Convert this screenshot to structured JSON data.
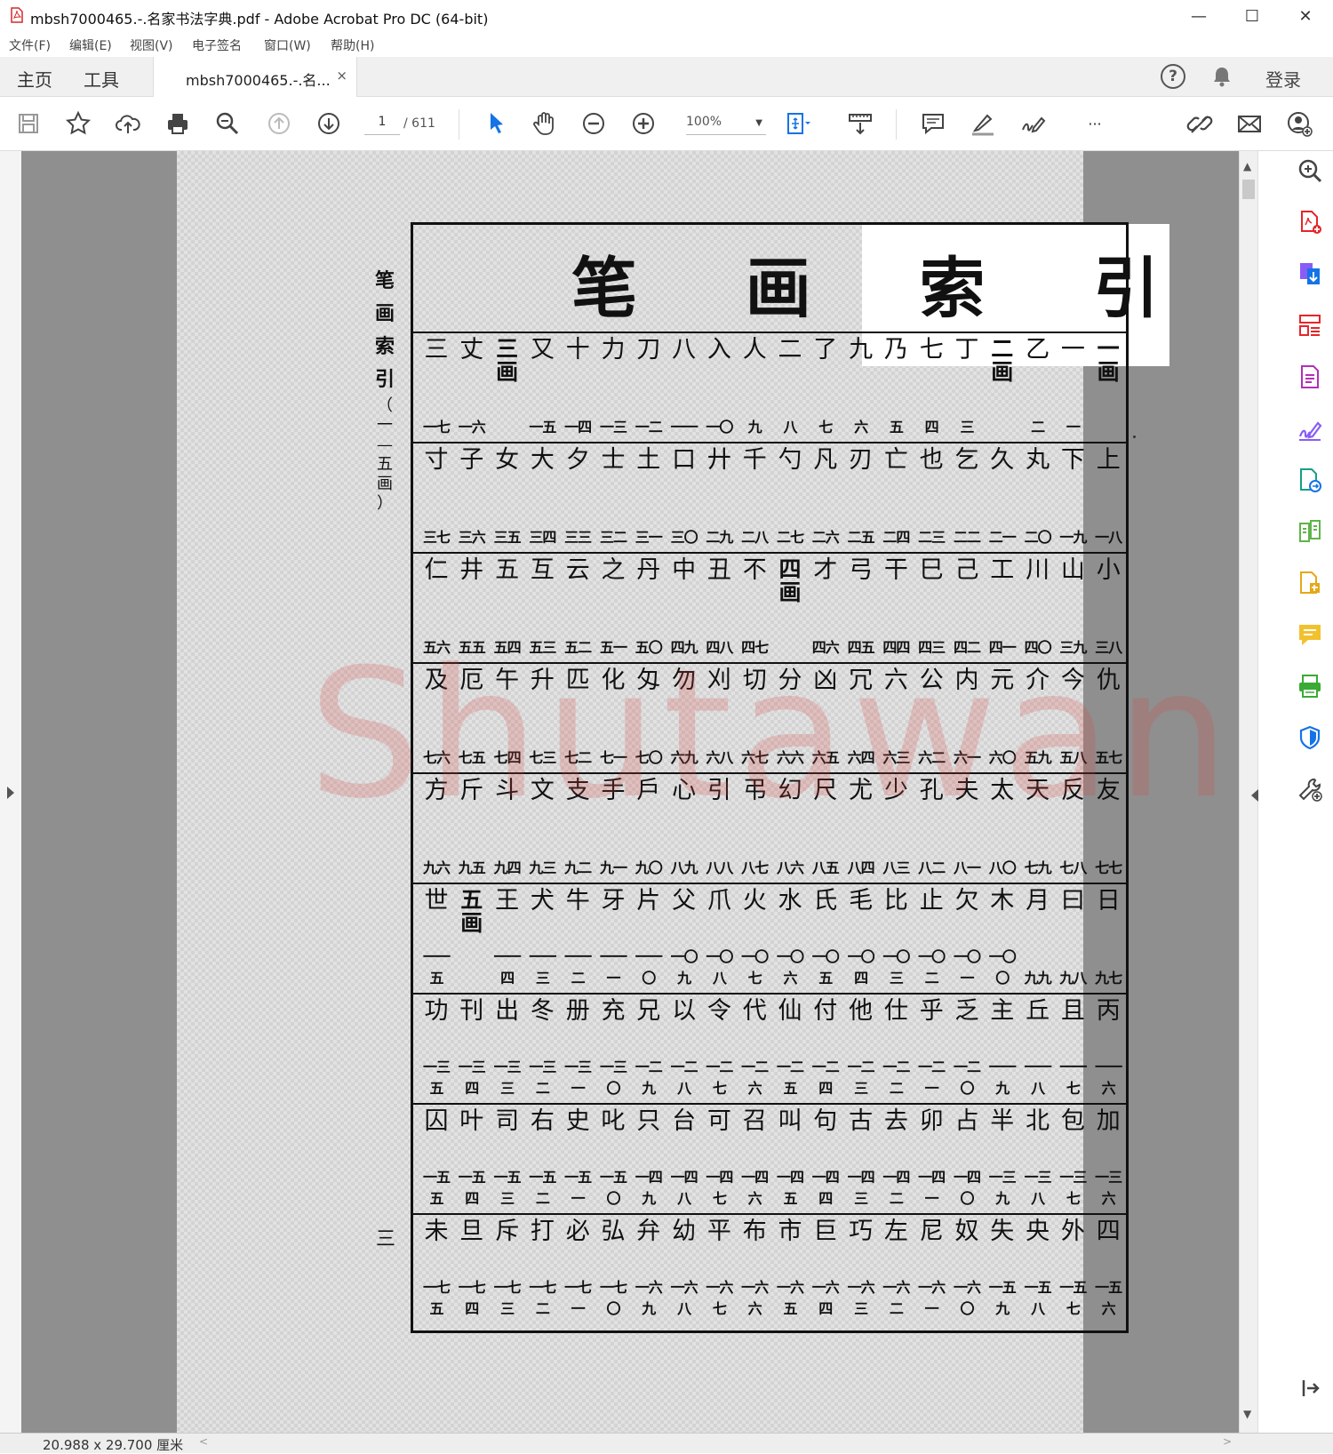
{
  "window": {
    "title": "mbsh7000465.-.名家书法字典.pdf - Adobe Acrobat Pro DC (64-bit)",
    "minimize": "—",
    "maximize": "☐",
    "close": "✕"
  },
  "menu": [
    "文件(F)",
    "编辑(E)",
    "视图(V)",
    "电子签名",
    "窗口(W)",
    "帮助(H)"
  ],
  "tabs": {
    "home": "主页",
    "tools": "工具",
    "document": "mbsh7000465.-.名...",
    "document_close": "×",
    "help": "?",
    "login": "登录"
  },
  "toolbar": {
    "page_current": "1",
    "page_total": "/ 611",
    "zoom": "100%",
    "more": "···"
  },
  "page": {
    "title": "笔 画 索 引",
    "side_label": [
      "笔",
      "画",
      "索",
      "引"
    ],
    "side_range": [
      "（",
      "一",
      "—",
      "五",
      "画",
      "）"
    ],
    "page_number": "三",
    "watermark": "Shutawang.CN",
    "rows": [
      {
        "cells": [
          {
            "ch": "一",
            "big": true,
            "sub": "画",
            "pg": ""
          },
          {
            "ch": "一",
            "pg": "一"
          },
          {
            "ch": "乙",
            "pg": "二"
          },
          {
            "ch": "二",
            "big": true,
            "sub": "画",
            "pg": ""
          },
          {
            "ch": "丁",
            "pg": "三"
          },
          {
            "ch": "七",
            "pg": "四"
          },
          {
            "ch": "乃",
            "pg": "五"
          },
          {
            "ch": "九",
            "pg": "六"
          },
          {
            "ch": "了",
            "pg": "七"
          },
          {
            "ch": "二",
            "pg": "八"
          },
          {
            "ch": "人",
            "pg": "九"
          },
          {
            "ch": "入",
            "pg": "一〇"
          },
          {
            "ch": "八",
            "pg": "一一"
          },
          {
            "ch": "刀",
            "pg": "一二"
          },
          {
            "ch": "力",
            "pg": "一三"
          },
          {
            "ch": "十",
            "pg": "一四"
          },
          {
            "ch": "又",
            "pg": "一五"
          },
          {
            "ch": "三",
            "big": true,
            "sub": "画",
            "pg": ""
          },
          {
            "ch": "丈",
            "pg": "一六"
          },
          {
            "ch": "三",
            "pg": "一七"
          }
        ]
      },
      {
        "cells": [
          {
            "ch": "上",
            "pg": "一八"
          },
          {
            "ch": "下",
            "pg": "一九"
          },
          {
            "ch": "丸",
            "pg": "二〇"
          },
          {
            "ch": "久",
            "pg": "二一"
          },
          {
            "ch": "乞",
            "pg": "二二"
          },
          {
            "ch": "也",
            "pg": "二三"
          },
          {
            "ch": "亡",
            "pg": "二四"
          },
          {
            "ch": "刃",
            "pg": "二五"
          },
          {
            "ch": "凡",
            "pg": "二六"
          },
          {
            "ch": "勺",
            "pg": "二七"
          },
          {
            "ch": "千",
            "pg": "二八"
          },
          {
            "ch": "廾",
            "pg": "二九"
          },
          {
            "ch": "口",
            "pg": "三〇"
          },
          {
            "ch": "土",
            "pg": "三一"
          },
          {
            "ch": "士",
            "pg": "三二"
          },
          {
            "ch": "夕",
            "pg": "三三"
          },
          {
            "ch": "大",
            "pg": "三四"
          },
          {
            "ch": "女",
            "pg": "三五"
          },
          {
            "ch": "子",
            "pg": "三六"
          },
          {
            "ch": "寸",
            "pg": "三七"
          }
        ]
      },
      {
        "cells": [
          {
            "ch": "小",
            "pg": "三八"
          },
          {
            "ch": "山",
            "pg": "三九"
          },
          {
            "ch": "川",
            "pg": "四〇"
          },
          {
            "ch": "工",
            "pg": "四一"
          },
          {
            "ch": "己",
            "pg": "四二"
          },
          {
            "ch": "巳",
            "pg": "四三"
          },
          {
            "ch": "干",
            "pg": "四四"
          },
          {
            "ch": "弓",
            "pg": "四五"
          },
          {
            "ch": "才",
            "pg": "四六"
          },
          {
            "ch": "四",
            "big": true,
            "sub": "画",
            "pg": ""
          },
          {
            "ch": "不",
            "pg": "四七"
          },
          {
            "ch": "丑",
            "pg": "四八"
          },
          {
            "ch": "中",
            "pg": "四九"
          },
          {
            "ch": "丹",
            "pg": "五〇"
          },
          {
            "ch": "之",
            "pg": "五一"
          },
          {
            "ch": "云",
            "pg": "五二"
          },
          {
            "ch": "互",
            "pg": "五三"
          },
          {
            "ch": "五",
            "pg": "五四"
          },
          {
            "ch": "井",
            "pg": "五五"
          },
          {
            "ch": "仁",
            "pg": "五六"
          }
        ]
      },
      {
        "cells": [
          {
            "ch": "仇",
            "pg": "五七"
          },
          {
            "ch": "今",
            "pg": "五八"
          },
          {
            "ch": "介",
            "pg": "五九"
          },
          {
            "ch": "元",
            "pg": "六〇"
          },
          {
            "ch": "内",
            "pg": "六一"
          },
          {
            "ch": "公",
            "pg": "六二"
          },
          {
            "ch": "六",
            "pg": "六三"
          },
          {
            "ch": "冗",
            "pg": "六四"
          },
          {
            "ch": "凶",
            "pg": "六五"
          },
          {
            "ch": "分",
            "pg": "六六"
          },
          {
            "ch": "切",
            "pg": "六七"
          },
          {
            "ch": "刈",
            "pg": "六八"
          },
          {
            "ch": "勿",
            "pg": "六九"
          },
          {
            "ch": "匁",
            "pg": "七〇"
          },
          {
            "ch": "化",
            "pg": "七一"
          },
          {
            "ch": "匹",
            "pg": "七二"
          },
          {
            "ch": "升",
            "pg": "七三"
          },
          {
            "ch": "午",
            "pg": "七四"
          },
          {
            "ch": "厄",
            "pg": "七五"
          },
          {
            "ch": "及",
            "pg": "七六"
          }
        ]
      },
      {
        "cells": [
          {
            "ch": "友",
            "pg": "七七"
          },
          {
            "ch": "反",
            "pg": "七八"
          },
          {
            "ch": "天",
            "pg": "七九"
          },
          {
            "ch": "太",
            "pg": "八〇"
          },
          {
            "ch": "夫",
            "pg": "八一"
          },
          {
            "ch": "孔",
            "pg": "八二"
          },
          {
            "ch": "少",
            "pg": "八三"
          },
          {
            "ch": "尤",
            "pg": "八四"
          },
          {
            "ch": "尺",
            "pg": "八五"
          },
          {
            "ch": "幻",
            "pg": "八六"
          },
          {
            "ch": "弔",
            "pg": "八七"
          },
          {
            "ch": "引",
            "pg": "八八"
          },
          {
            "ch": "心",
            "pg": "八九"
          },
          {
            "ch": "戶",
            "pg": "九〇"
          },
          {
            "ch": "手",
            "pg": "九一"
          },
          {
            "ch": "支",
            "pg": "九二"
          },
          {
            "ch": "文",
            "pg": "九三"
          },
          {
            "ch": "斗",
            "pg": "九四"
          },
          {
            "ch": "斤",
            "pg": "九五"
          },
          {
            "ch": "方",
            "pg": "九六"
          }
        ]
      },
      {
        "cells": [
          {
            "ch": "日",
            "pg": "九七"
          },
          {
            "ch": "曰",
            "pg": "九八"
          },
          {
            "ch": "月",
            "pg": "九九"
          },
          {
            "ch": "木",
            "pg": "一〇〇"
          },
          {
            "ch": "欠",
            "pg": "一〇一"
          },
          {
            "ch": "止",
            "pg": "一〇二"
          },
          {
            "ch": "比",
            "pg": "一〇三"
          },
          {
            "ch": "毛",
            "pg": "一〇四"
          },
          {
            "ch": "氏",
            "pg": "一〇五"
          },
          {
            "ch": "水",
            "pg": "一〇六"
          },
          {
            "ch": "火",
            "pg": "一〇七"
          },
          {
            "ch": "爪",
            "pg": "一〇八"
          },
          {
            "ch": "父",
            "pg": "一〇九"
          },
          {
            "ch": "片",
            "pg": "一一〇"
          },
          {
            "ch": "牙",
            "pg": "一一一"
          },
          {
            "ch": "牛",
            "pg": "一一二"
          },
          {
            "ch": "犬",
            "pg": "一一三"
          },
          {
            "ch": "王",
            "pg": "一一四"
          },
          {
            "ch": "五",
            "big": true,
            "sub": "画",
            "pg": ""
          },
          {
            "ch": "世",
            "pg": "一一五"
          }
        ]
      },
      {
        "cells": [
          {
            "ch": "丙",
            "pg": "一一六"
          },
          {
            "ch": "且",
            "pg": "一一七"
          },
          {
            "ch": "丘",
            "pg": "一一八"
          },
          {
            "ch": "主",
            "pg": "一一九"
          },
          {
            "ch": "乏",
            "pg": "一二〇"
          },
          {
            "ch": "乎",
            "pg": "一二一"
          },
          {
            "ch": "仕",
            "pg": "一二二"
          },
          {
            "ch": "他",
            "pg": "一二三"
          },
          {
            "ch": "付",
            "pg": "一二四"
          },
          {
            "ch": "仙",
            "pg": "一二五"
          },
          {
            "ch": "代",
            "pg": "一二六"
          },
          {
            "ch": "令",
            "pg": "一二七"
          },
          {
            "ch": "以",
            "pg": "一二八"
          },
          {
            "ch": "兄",
            "pg": "一二九"
          },
          {
            "ch": "充",
            "pg": "一三〇"
          },
          {
            "ch": "册",
            "pg": "一三一"
          },
          {
            "ch": "冬",
            "pg": "一三二"
          },
          {
            "ch": "出",
            "pg": "一三三"
          },
          {
            "ch": "刊",
            "pg": "一三四"
          },
          {
            "ch": "功",
            "pg": "一三五"
          }
        ]
      },
      {
        "cells": [
          {
            "ch": "加",
            "pg": "一三六"
          },
          {
            "ch": "包",
            "pg": "一三七"
          },
          {
            "ch": "北",
            "pg": "一三八"
          },
          {
            "ch": "半",
            "pg": "一三九"
          },
          {
            "ch": "占",
            "pg": "一四〇"
          },
          {
            "ch": "卯",
            "pg": "一四一"
          },
          {
            "ch": "去",
            "pg": "一四二"
          },
          {
            "ch": "古",
            "pg": "一四三"
          },
          {
            "ch": "句",
            "pg": "一四四"
          },
          {
            "ch": "叫",
            "pg": "一四五"
          },
          {
            "ch": "召",
            "pg": "一四六"
          },
          {
            "ch": "可",
            "pg": "一四七"
          },
          {
            "ch": "台",
            "pg": "一四八"
          },
          {
            "ch": "只",
            "pg": "一四九"
          },
          {
            "ch": "叱",
            "pg": "一五〇"
          },
          {
            "ch": "史",
            "pg": "一五一"
          },
          {
            "ch": "右",
            "pg": "一五二"
          },
          {
            "ch": "司",
            "pg": "一五三"
          },
          {
            "ch": "叶",
            "pg": "一五四"
          },
          {
            "ch": "囚",
            "pg": "一五五"
          }
        ]
      },
      {
        "cells": [
          {
            "ch": "四",
            "pg": "一五六"
          },
          {
            "ch": "外",
            "pg": "一五七"
          },
          {
            "ch": "央",
            "pg": "一五八"
          },
          {
            "ch": "失",
            "pg": "一五九"
          },
          {
            "ch": "奴",
            "pg": "一六〇"
          },
          {
            "ch": "尼",
            "pg": "一六一"
          },
          {
            "ch": "左",
            "pg": "一六二"
          },
          {
            "ch": "巧",
            "pg": "一六三"
          },
          {
            "ch": "巨",
            "pg": "一六四"
          },
          {
            "ch": "市",
            "pg": "一六五"
          },
          {
            "ch": "布",
            "pg": "一六六"
          },
          {
            "ch": "平",
            "pg": "一六七"
          },
          {
            "ch": "幼",
            "pg": "一六八"
          },
          {
            "ch": "弁",
            "pg": "一六九"
          },
          {
            "ch": "弘",
            "pg": "一七〇"
          },
          {
            "ch": "必",
            "pg": "一七一"
          },
          {
            "ch": "打",
            "pg": "一七二"
          },
          {
            "ch": "斥",
            "pg": "一七三"
          },
          {
            "ch": "旦",
            "pg": "一七四"
          },
          {
            "ch": "未",
            "pg": "一七五"
          }
        ]
      }
    ]
  },
  "status": {
    "page_size": "20.988 x 29.700 厘米",
    "scroll_left": "<",
    "scroll_right": ">"
  },
  "colors": {
    "pdf_red": "#e4262a",
    "acrobat_blue": "#1473e6",
    "watermark": "#dc4646"
  }
}
